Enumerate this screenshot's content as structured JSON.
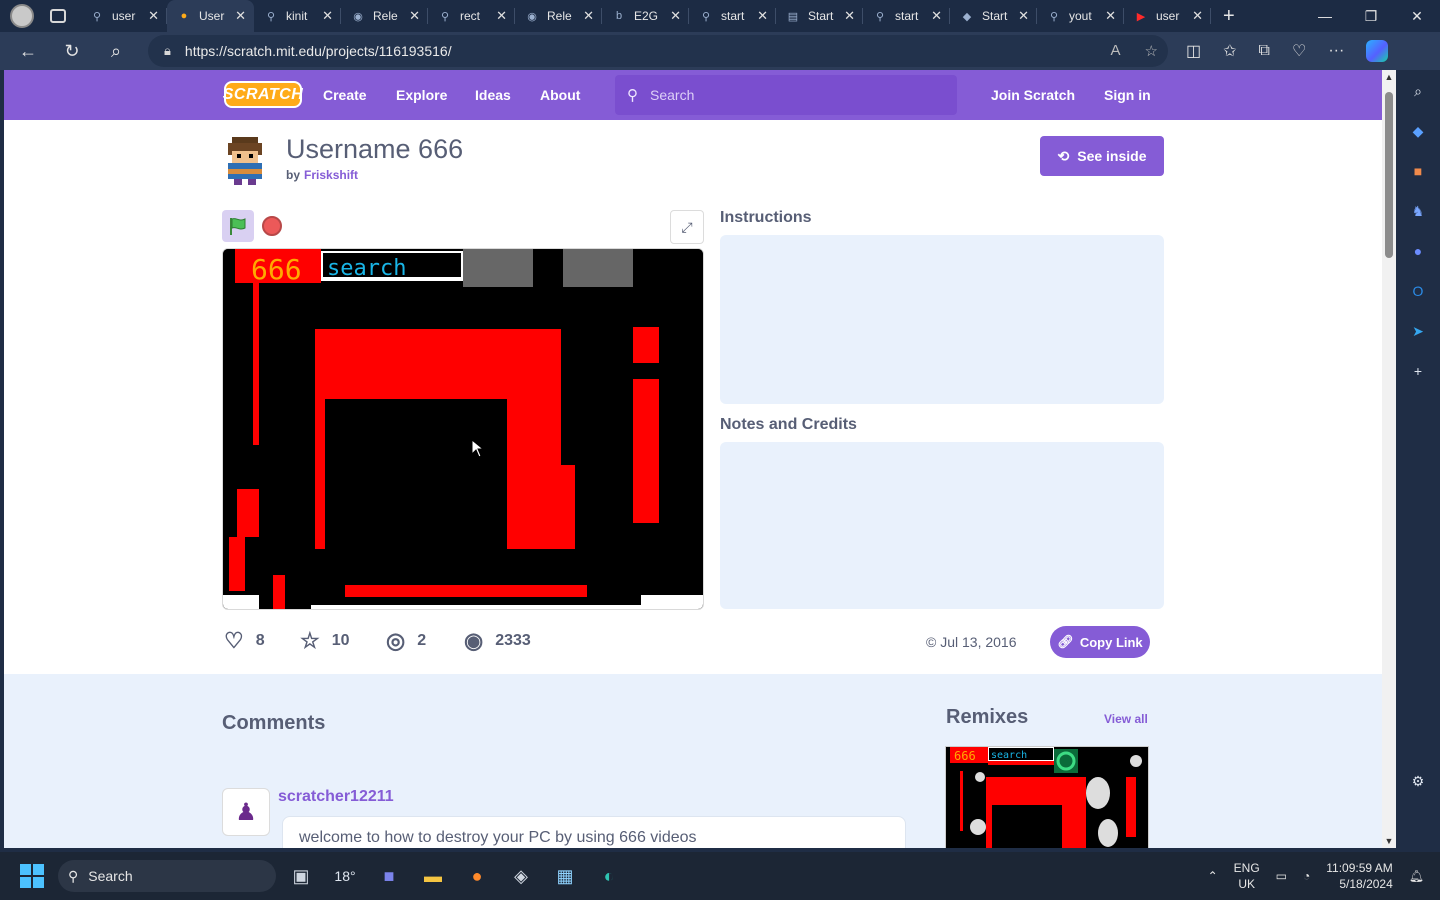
{
  "browser": {
    "tabs": [
      {
        "title": "user",
        "icon": "search-icon"
      },
      {
        "title": "User",
        "icon": "scratch-favicon",
        "active": true
      },
      {
        "title": "kinit",
        "icon": "search-icon"
      },
      {
        "title": "Rele",
        "icon": "github-icon"
      },
      {
        "title": "rect",
        "icon": "search-icon"
      },
      {
        "title": "Rele",
        "icon": "github-icon"
      },
      {
        "title": "E2G",
        "icon": "bing-icon"
      },
      {
        "title": "start",
        "icon": "search-icon"
      },
      {
        "title": "Start",
        "icon": "document-icon"
      },
      {
        "title": "start",
        "icon": "search-icon"
      },
      {
        "title": "Start",
        "icon": "app-icon"
      },
      {
        "title": "yout",
        "icon": "search-icon"
      },
      {
        "title": "user",
        "icon": "youtube-icon"
      }
    ],
    "url": "https://scratch.mit.edu/projects/116193516/"
  },
  "scratch": {
    "logo": "SCRATCH",
    "nav": [
      "Create",
      "Explore",
      "Ideas",
      "About"
    ],
    "search_placeholder": "Search",
    "join": "Join Scratch",
    "signin": "Sign in"
  },
  "project": {
    "title": "Username 666",
    "by_label": "by",
    "author": "Friskshift",
    "see_inside": "See inside",
    "stage_text": {
      "num": "666",
      "search": "search"
    },
    "instructions_label": "Instructions",
    "notes_label": "Notes and Credits",
    "stats": {
      "loves": "8",
      "favorites": "10",
      "remixes": "2",
      "views": "2333"
    },
    "date": "Jul 13, 2016",
    "copy_link": "Copy Link"
  },
  "comments": {
    "title": "Comments",
    "items": [
      {
        "user": "scratcher12211",
        "text": "welcome to how to destroy your PC by using 666 videos"
      }
    ]
  },
  "remixes": {
    "title": "Remixes",
    "view_all": "View all",
    "thumb_text": {
      "num": "666",
      "search": "search"
    }
  },
  "taskbar": {
    "search": "Search",
    "weather": "18°",
    "lang_top": "ENG",
    "lang_bottom": "UK",
    "time": "11:09:59 AM",
    "date": "5/18/2024"
  },
  "colors": {
    "scratch_purple": "#855cd6",
    "stage_red": "#ff0000",
    "panel_blue": "#e9f1fc"
  }
}
